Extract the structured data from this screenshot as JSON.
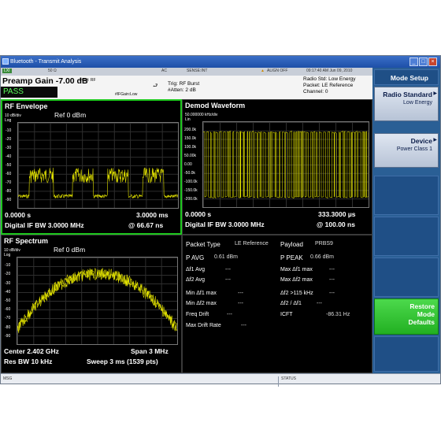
{
  "window": {
    "title": "Bluetooth - Transmit Analysis",
    "controls": [
      "_",
      "□",
      "×"
    ]
  },
  "status_row": {
    "lxi": "LXI",
    "z": "50 Ω",
    "ac": "AC",
    "sense": "SENSE:INT",
    "align": "ALIGN OFF",
    "datetime": "09:17:40 AM Jun 09, 2010"
  },
  "info": {
    "preamp": "Preamp Gain  -7.00 dB",
    "pass": "PASS",
    "input": "Input: RF",
    "ifgain": "#IFGain:Low",
    "trig_line1": "Trig: RF Burst",
    "trig_line2": "#Atten: 2 dB",
    "radio_std": "Radio Std: Low Energy",
    "packet": "Packet: LE Reference",
    "channel": "Channel: 0"
  },
  "panels": {
    "rf_envelope": {
      "title": "RF Envelope",
      "ref": "Ref  0 dBm",
      "scale": "10 dB/div",
      "scale_type": "Log",
      "ticks": [
        "-10",
        "-20",
        "-30",
        "-40",
        "-50",
        "-60",
        "-70",
        "-80",
        "-90"
      ],
      "x_start": "0.0000 s",
      "x_stop": "3.0000 ms",
      "bw": "Digital IF BW 3.0000 MHz",
      "rate": "@ 66.67 ns"
    },
    "demod_waveform": {
      "title": "Demod Waveform",
      "scale": "50.000000 kHz/div",
      "scale_type": "Lin",
      "ticks": [
        "200.0k",
        "150.0k",
        "100.0k",
        "50.00k",
        "0.00",
        "-50.0k",
        "-100.0k",
        "-150.0k",
        "-200.0k"
      ],
      "x_start": "0.0000 s",
      "x_stop": "333.3000 µs",
      "bw": "Digital IF BW 3.0000 MHz",
      "rate": "@ 100.00 ns"
    },
    "rf_spectrum": {
      "title": "RF Spectrum",
      "ref": "Ref  0 dBm",
      "scale": "10 dB/div",
      "scale_type": "Log",
      "ticks": [
        "-10",
        "-20",
        "-30",
        "-40",
        "-50",
        "-60",
        "-70",
        "-80",
        "-90"
      ],
      "center": "Center  2.402 GHz",
      "span": "Span 3 MHz",
      "res_bw": "Res BW  10 kHz",
      "sweep": "Sweep  3 ms (1539 pts)"
    },
    "metrics": {
      "packet_type_label": "Packet Type",
      "packet_type_value": "LE Reference",
      "payload_label": "Payload",
      "payload_value": "PRBS9",
      "p_avg_label": "P AVG",
      "p_avg_value": "0.61 dBm",
      "p_peak_label": "P PEAK",
      "p_peak_value": "0.66 dBm",
      "df1avg_label": "Δf1 Avg",
      "df1avg_value": "---",
      "maxdf1_label": "Max Δf1 max",
      "maxdf1_value": "---",
      "df2avg_label": "Δf2 Avg",
      "df2avg_value": "---",
      "maxdf2_label": "Max Δf2 max",
      "maxdf2_value": "---",
      "mindf1_label": "Min Δf1 max",
      "mindf1_value": "---",
      "df2gt_label": "Δf2 >115 kHz",
      "df2gt_value": "---",
      "mindf2_label": "Min Δf2 max",
      "mindf2_value": "---",
      "ratio_label": "Δf2 / Δf1",
      "ratio_value": "---",
      "freqdrift_label": "Freq Drift",
      "freqdrift_value": "---",
      "icft_label": "ICFT",
      "icft_value": "-86.31 Hz",
      "maxdriftrate_label": "Max Drift Rate",
      "maxdriftrate_value": "---"
    }
  },
  "softkeys": {
    "menu": "Mode Setup",
    "radio_standard": {
      "label": "Radio Standard",
      "value": "Low Energy"
    },
    "device": {
      "label": "Device",
      "value": "Power Class 1"
    },
    "restore_line1": "Restore",
    "restore_line2": "Mode",
    "restore_line3": "Defaults"
  },
  "msgbar": {
    "msg": "MSG",
    "status": "STATUS"
  },
  "colors": {
    "trace": "#e6e600",
    "active_border": "#1ec81e",
    "pass_text": "#5cff5c",
    "softkey_green": "#22b022"
  }
}
